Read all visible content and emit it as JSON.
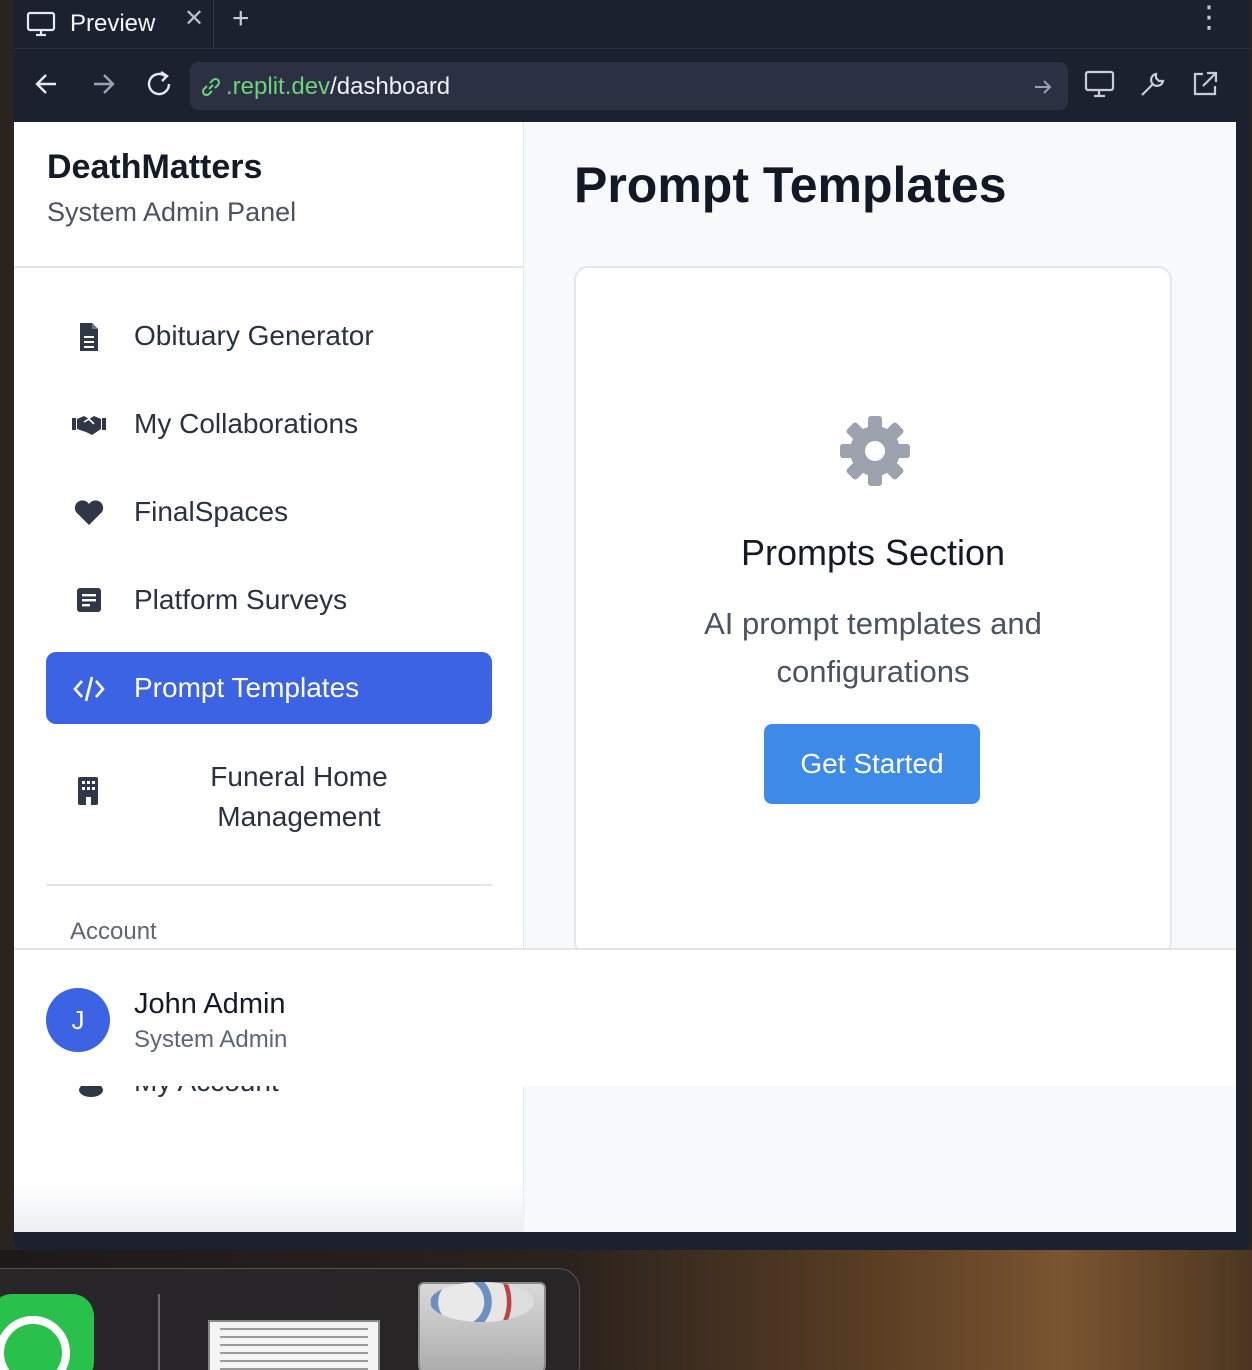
{
  "browser": {
    "tab_title": "Preview",
    "tab_icon": "monitor-icon",
    "url_host": ".replit.dev",
    "url_path": "/dashboard"
  },
  "sidebar": {
    "brand": "DeathMatters",
    "subtitle": "System Admin Panel",
    "items": [
      {
        "label": "Obituary Generator",
        "icon": "document-icon",
        "active": false
      },
      {
        "label": "My Collaborations",
        "icon": "handshake-icon",
        "active": false
      },
      {
        "label": "FinalSpaces",
        "icon": "heart-icon",
        "active": false
      },
      {
        "label": "Platform Surveys",
        "icon": "survey-icon",
        "active": false
      },
      {
        "label": "Prompt Templates",
        "icon": "code-icon",
        "active": true
      },
      {
        "label": "Funeral Home Management",
        "icon": "building-icon",
        "active": false
      }
    ],
    "account_header": "Account",
    "my_account_label": "My Account"
  },
  "main": {
    "title": "Prompt Templates",
    "card": {
      "icon": "gear-icon",
      "title": "Prompts Section",
      "description": "AI prompt templates and configurations",
      "button": "Get Started"
    }
  },
  "user": {
    "initial": "J",
    "name": "John Admin",
    "role": "System Admin"
  },
  "colors": {
    "accent": "#3b63e4",
    "button": "#3d8ae8",
    "chrome": "#1c2130"
  }
}
